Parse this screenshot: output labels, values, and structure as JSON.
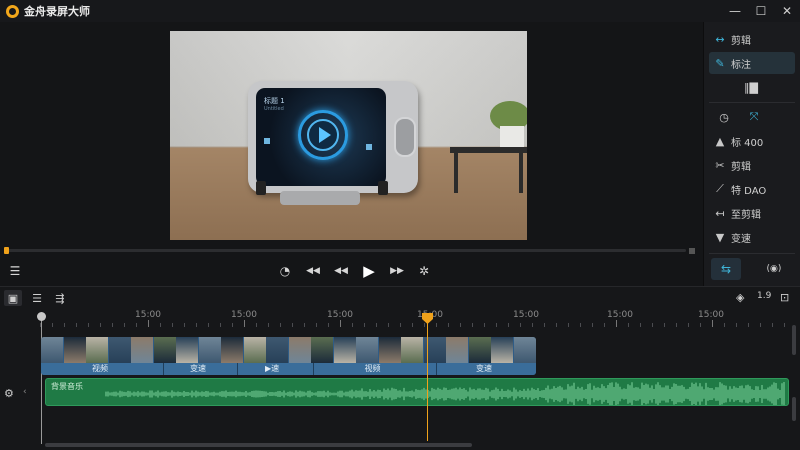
{
  "app": {
    "title": "金舟录屏大师"
  },
  "window_controls": {
    "minimize": "—",
    "maximize": "☐",
    "close": "✕"
  },
  "preview": {
    "screen_title": "标题 1",
    "screen_subtitle": "Untitled",
    "seek_progress": 0.0
  },
  "playback": {
    "subtitle_icon": "☰",
    "timer_icon": "◔",
    "rewind_icon": "◀◀",
    "prev_icon": "◀◀",
    "play_icon": "▶",
    "next_icon": "▶▶",
    "settings_icon": "✲"
  },
  "right_panel": {
    "items": [
      {
        "icon": "↔",
        "label": "剪辑"
      },
      {
        "icon": "✎",
        "label": "标注"
      },
      {
        "icon": "‖▇",
        "label": ""
      },
      {
        "icon": "◷",
        "label": ""
      },
      {
        "icon": "▲",
        "label": "标 400"
      },
      {
        "icon": "✂",
        "label": "剪辑"
      },
      {
        "icon": "⟋",
        "label": "特 DAO"
      },
      {
        "icon": "↤",
        "label": "至剪辑"
      },
      {
        "icon": "▼",
        "label": "变速"
      }
    ],
    "crop_icon": "⤧",
    "bottom_left_icon": "⇆",
    "bottom_right_icon": "(◉)"
  },
  "timeline": {
    "tools": [
      "▣",
      "☰",
      "⇶"
    ],
    "zoom_icon": "◈",
    "zoom_value": "1.9",
    "fit_icon": "⊡",
    "ruler_labels": [
      "15:00",
      "15:00",
      "15:00",
      "15:00",
      "15:00",
      "15:00",
      "15:00"
    ],
    "clips": [
      {
        "label": "视频"
      },
      {
        "label": "变速"
      },
      {
        "label": "▶速"
      },
      {
        "label": "视频"
      },
      {
        "label": "变速"
      }
    ],
    "audio_label": "背景音乐",
    "lock_icon": "⚙",
    "collapse_icon": "‹"
  }
}
